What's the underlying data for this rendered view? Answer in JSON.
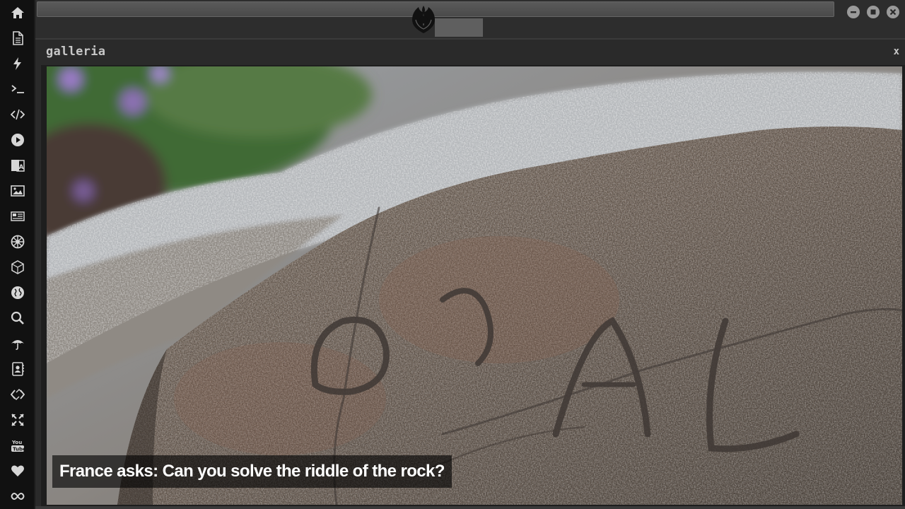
{
  "sidebar": {
    "icons": [
      {
        "name": "home-icon"
      },
      {
        "name": "document-icon"
      },
      {
        "name": "lightning-icon"
      },
      {
        "name": "terminal-icon"
      },
      {
        "name": "code-icon"
      },
      {
        "name": "play-icon"
      },
      {
        "name": "translate-icon"
      },
      {
        "name": "image-icon"
      },
      {
        "name": "newspaper-icon"
      },
      {
        "name": "galactic-empire-icon"
      },
      {
        "name": "dice-icon"
      },
      {
        "name": "globe-icon"
      },
      {
        "name": "search-icon"
      },
      {
        "name": "umbrella-icon"
      },
      {
        "name": "contact-icon"
      },
      {
        "name": "code-fork-icon"
      },
      {
        "name": "expand-icon"
      },
      {
        "name": "youtube-icon"
      },
      {
        "name": "heart-icon"
      },
      {
        "name": "infinity-icon"
      }
    ]
  },
  "topbar": {
    "logo": "rebel-alliance-icon"
  },
  "gallery": {
    "title": "galleria",
    "close_label": "x",
    "caption": "France asks: Can you solve the riddle of the rock?"
  },
  "colors": {
    "sidebar_bg": "#111111",
    "icon": "#d6d6d6",
    "window_bg": "#2a2a2a"
  }
}
